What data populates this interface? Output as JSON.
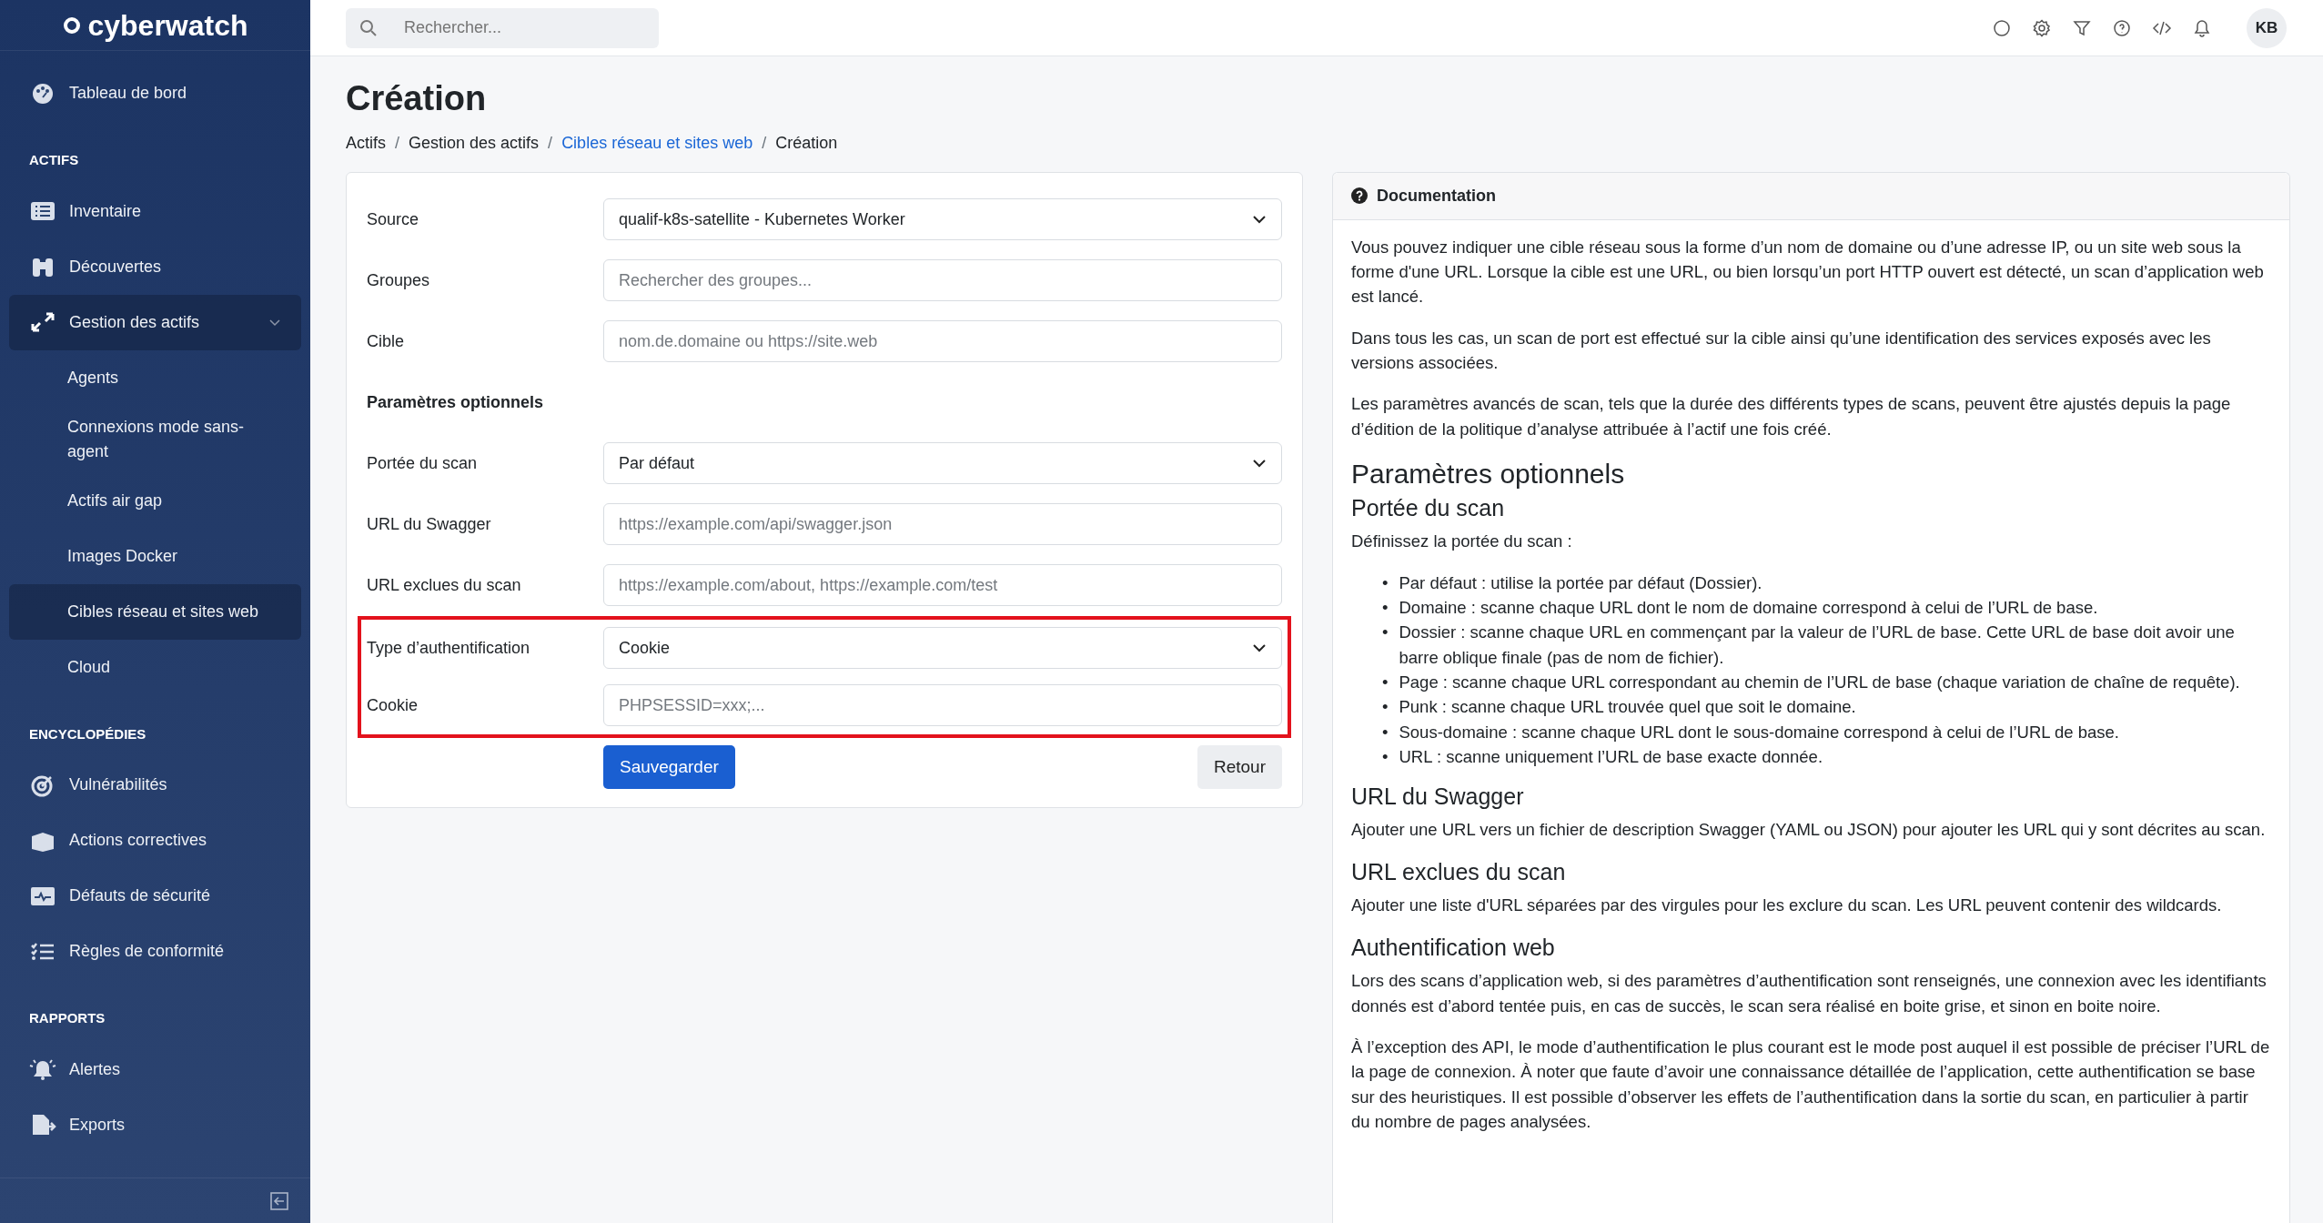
{
  "brand": {
    "name": "cyberwatch"
  },
  "sidebar": {
    "sections": [
      {
        "items": [
          {
            "label": "Tableau de bord",
            "selected": false
          }
        ]
      },
      {
        "title": "ACTIFS",
        "items": [
          {
            "label": "Inventaire",
            "selected": false
          },
          {
            "label": "Découvertes",
            "selected": false
          },
          {
            "label": "Gestion des actifs",
            "expanded": true,
            "children": [
              {
                "label": "Agents",
                "selected": false
              },
              {
                "label": "Connexions mode sans-agent",
                "selected": false
              },
              {
                "label": "Actifs air gap",
                "selected": false
              },
              {
                "label": "Images Docker",
                "selected": false
              },
              {
                "label": "Cibles réseau et sites web",
                "selected": true
              },
              {
                "label": "Cloud",
                "selected": false
              }
            ]
          }
        ]
      },
      {
        "title": "ENCYCLOPÉDIES",
        "items": [
          {
            "label": "Vulnérabilités",
            "selected": false
          },
          {
            "label": "Actions correctives",
            "selected": false
          },
          {
            "label": "Défauts de sécurité",
            "selected": false
          },
          {
            "label": "Règles de conformité",
            "selected": false
          }
        ]
      },
      {
        "title": "RAPPORTS",
        "items": [
          {
            "label": "Alertes",
            "selected": false
          },
          {
            "label": "Exports",
            "selected": false
          }
        ]
      }
    ]
  },
  "topbar": {
    "search": {
      "placeholder": "Rechercher..."
    },
    "avatar": "KB"
  },
  "page": {
    "title": "Création",
    "breadcrumb_separator": "/",
    "breadcrumb": [
      {
        "label": "Actifs",
        "link": false
      },
      {
        "label": "Gestion des actifs",
        "link": false
      },
      {
        "label": "Cibles réseau et sites web",
        "link": true
      },
      {
        "label": "Création",
        "link": false
      }
    ]
  },
  "form": {
    "fields": [
      {
        "kind": "select",
        "label": "Source",
        "value": "qualif-k8s-satellite - Kubernetes Worker",
        "highlighted": false
      },
      {
        "kind": "input",
        "label": "Groupes",
        "placeholder": "Rechercher des groupes...",
        "highlighted": false
      },
      {
        "kind": "input",
        "label": "Cible",
        "placeholder": "nom.de.domaine ou https://site.web",
        "highlighted": false
      },
      {
        "kind": "heading",
        "label": "Paramètres optionnels"
      },
      {
        "kind": "select",
        "label": "Portée du scan",
        "value": "Par défaut",
        "highlighted": false
      },
      {
        "kind": "input",
        "label": "URL du Swagger",
        "placeholder": "https://example.com/api/swagger.json",
        "highlighted": false
      },
      {
        "kind": "input",
        "label": "URL exclues du scan",
        "placeholder": "https://example.com/about, https://example.com/test",
        "highlighted": false
      },
      {
        "kind": "select",
        "label": "Type d’authentification",
        "value": "Cookie",
        "highlighted": true
      },
      {
        "kind": "input",
        "label": "Cookie",
        "placeholder": "PHPSESSID=xxx;...",
        "highlighted": true
      }
    ],
    "save_button": "Sauvegarder",
    "back_button": "Retour"
  },
  "documentation": {
    "title": "Documentation",
    "blocks": [
      {
        "kind": "p",
        "text": "Vous pouvez indiquer une cible réseau sous la forme d’un nom de domaine ou d’une adresse IP, ou un site web sous la forme d'une URL. Lorsque la cible est une URL, ou bien lorsqu’un port HTTP ouvert est détecté, un scan d’application web est lancé."
      },
      {
        "kind": "p",
        "text": "Dans tous les cas, un scan de port est effectué sur la cible ainsi qu’une identification des services exposés avec les versions associées."
      },
      {
        "kind": "p",
        "text": "Les paramètres avancés de scan, tels que la durée des différents types de scans, peuvent être ajustés depuis la page d’édition de la politique d’analyse attribuée à l’actif une fois créé."
      },
      {
        "kind": "h3",
        "text": "Paramètres optionnels"
      },
      {
        "kind": "h4",
        "text": "Portée du scan"
      },
      {
        "kind": "p",
        "text": "Définissez la portée du scan :"
      },
      {
        "kind": "ul",
        "marker": "•",
        "items": [
          "Par défaut : utilise la portée par défaut (Dossier).",
          "Domaine : scanne chaque URL dont le nom de domaine correspond à celui de l’URL de base.",
          "Dossier : scanne chaque URL en commençant par la valeur de l’URL de base. Cette URL de base doit avoir une barre oblique finale (pas de nom de fichier).",
          "Page : scanne chaque URL correspondant au chemin de l’URL de base (chaque variation de chaîne de requête).",
          "Punk : scanne chaque URL trouvée quel que soit le domaine.",
          "Sous-domaine : scanne chaque URL dont le sous-domaine correspond à celui de l’URL de base.",
          "URL : scanne uniquement l’URL de base exacte donnée."
        ]
      },
      {
        "kind": "h4",
        "text": "URL du Swagger"
      },
      {
        "kind": "p",
        "text": "Ajouter une URL vers un fichier de description Swagger (YAML ou JSON) pour ajouter les URL qui y sont décrites au scan."
      },
      {
        "kind": "h4",
        "text": "URL exclues du scan"
      },
      {
        "kind": "p",
        "text": "Ajouter une liste d'URL séparées par des virgules pour les exclure du scan. Les URL peuvent contenir des wildcards."
      },
      {
        "kind": "h4",
        "text": "Authentification web"
      },
      {
        "kind": "p",
        "text": "Lors des scans d’application web, si des paramètres d’authentification sont renseignés, une connexion avec les identifiants donnés est d’abord tentée puis, en cas de succès, le scan sera réalisé en boite grise, et sinon en boite noire."
      },
      {
        "kind": "p",
        "text": "À l’exception des API, le mode d’authentification le plus courant est le mode post auquel il est possible de préciser l’URL de la page de connexion. À noter que faute d’avoir une connaissance détaillée de l’application, cette authentification se base sur des heuristiques. Il est possible d’observer les effets de l’authentification dans la sortie du scan, en particulier à partir du nombre de pages analysées."
      }
    ]
  }
}
